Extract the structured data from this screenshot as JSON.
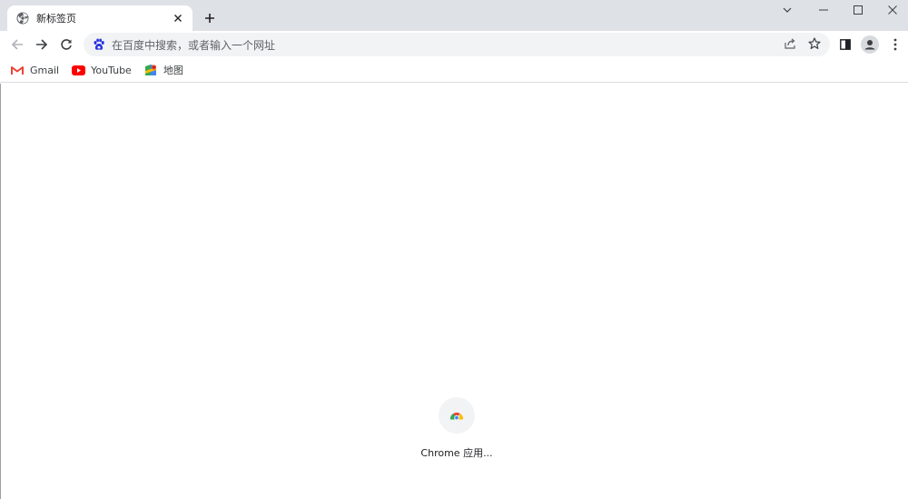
{
  "tab": {
    "title": "新标签页",
    "favicon": "chrome-globe-icon"
  },
  "window_controls": [
    "chevron-down-icon",
    "minimize-icon",
    "maximize-icon",
    "close-icon"
  ],
  "omnibox": {
    "placeholder": "在百度中搜索，或者输入一个网址",
    "search_engine_icon": "baidu-icon"
  },
  "bookmarks": [
    {
      "label": "Gmail",
      "icon": "gmail-icon"
    },
    {
      "label": "YouTube",
      "icon": "youtube-icon"
    },
    {
      "label": "地图",
      "icon": "maps-icon"
    }
  ],
  "shortcuts": [
    {
      "label": "Chrome 应用...",
      "icon": "chrome-web-store-icon"
    }
  ],
  "colors": {
    "tabstrip": "#dee1e6",
    "omnibox": "#f1f3f4",
    "icon": "#5f6368"
  }
}
